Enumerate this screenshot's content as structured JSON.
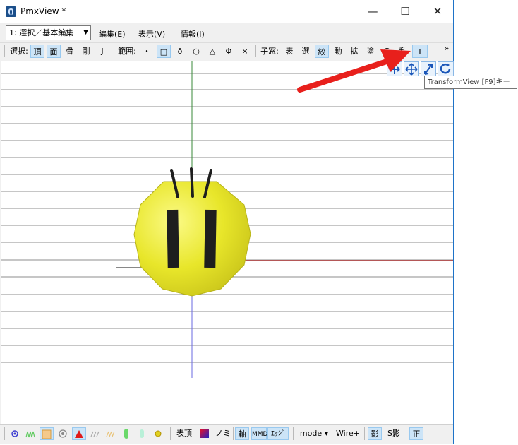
{
  "window": {
    "title": "PmxView *",
    "minimize": "—",
    "maximize": "☐",
    "close": "✕"
  },
  "menubar": {
    "mode_combo": "1: 選択／基本編集",
    "items": [
      "編集(E)",
      "表示(V)",
      "情報(I)"
    ]
  },
  "toolbar": {
    "select_label": "選択:",
    "select_items": [
      "頂",
      "面",
      "骨",
      "剛",
      "J"
    ],
    "range_label": "範囲:",
    "range_items": [
      "・",
      "□",
      "δ",
      "○",
      "△",
      "Φ",
      "×"
    ],
    "child_label": "子窓:",
    "child_items": [
      "表",
      "選",
      "絞",
      "動",
      "拡",
      "塗",
      "G",
      "乱",
      "T"
    ],
    "overflow": "»"
  },
  "tooltip": {
    "text": "TransformView  [F9]キー"
  },
  "statusbar": {
    "vertex_label": "表頂",
    "no_label": "ノミ",
    "axis_label": "軸",
    "mmd_label": "MMD",
    "edge_label": "ｴｯｼﾞ",
    "mode_label": "mode ▾",
    "wire_label": "Wire+",
    "shadow_label": "影",
    "sshadow_label": "S影",
    "ortho_label": "正"
  },
  "colors": {
    "accent": "#1e73c8",
    "selected_bg": "#cce4f7",
    "arrow": "#e8201c",
    "ball": "#e8e62a",
    "axis_red": "#d22",
    "axis_green": "#3a8a3a",
    "axis_blue": "#6a6ae0"
  },
  "icons": {
    "app": "pmxview-app-icon",
    "transform": [
      "move-xz-icon",
      "move-xy-icon",
      "rotate-tilt-icon",
      "rotate-icon"
    ]
  }
}
